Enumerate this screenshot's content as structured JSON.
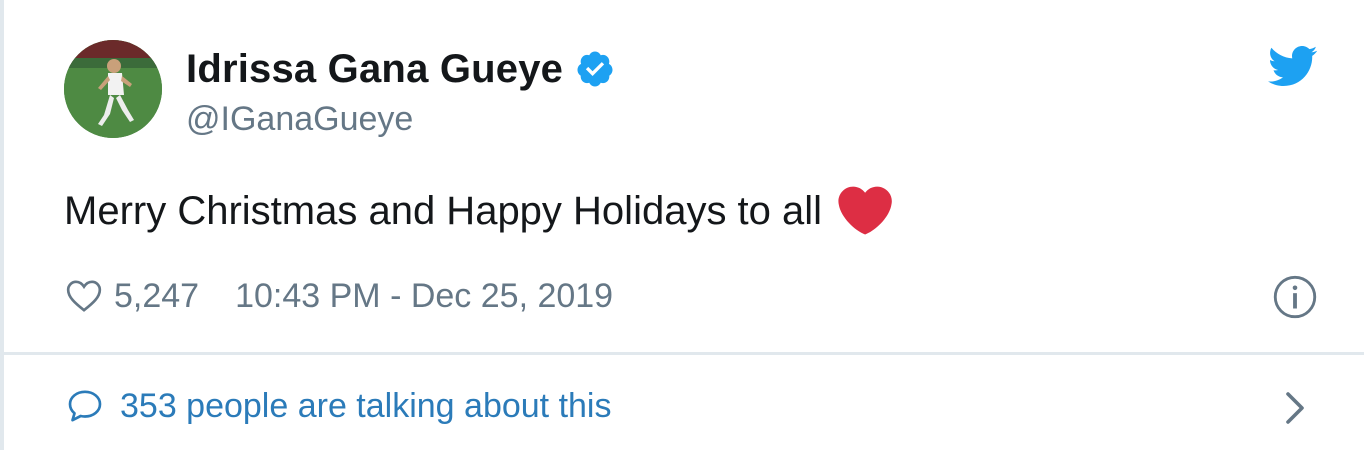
{
  "tweet": {
    "author": {
      "display_name": "Idrissa Gana Gueye",
      "handle": "@IGanaGueye",
      "verified": true,
      "avatar_icon": "player-avatar"
    },
    "text": "Merry Christmas and Happy Holidays to all",
    "emoji": "red-heart",
    "likes": "5,247",
    "timestamp": "10:43 PM - Dec 25, 2019",
    "conversation": {
      "label": "353 people are talking about this"
    }
  },
  "icons": {
    "brand": "twitter-bird-icon",
    "verified": "verified-badge-icon",
    "like": "heart-outline-icon",
    "info": "info-circle-icon",
    "reply": "speech-bubble-icon",
    "chevron": "chevron-right-icon"
  },
  "colors": {
    "twitter_blue": "#1da1f2",
    "link_blue": "#2b7bb9",
    "text_primary": "#14171a",
    "text_secondary": "#657786",
    "heart_red": "#e0245e",
    "border": "#e1e8ed"
  }
}
